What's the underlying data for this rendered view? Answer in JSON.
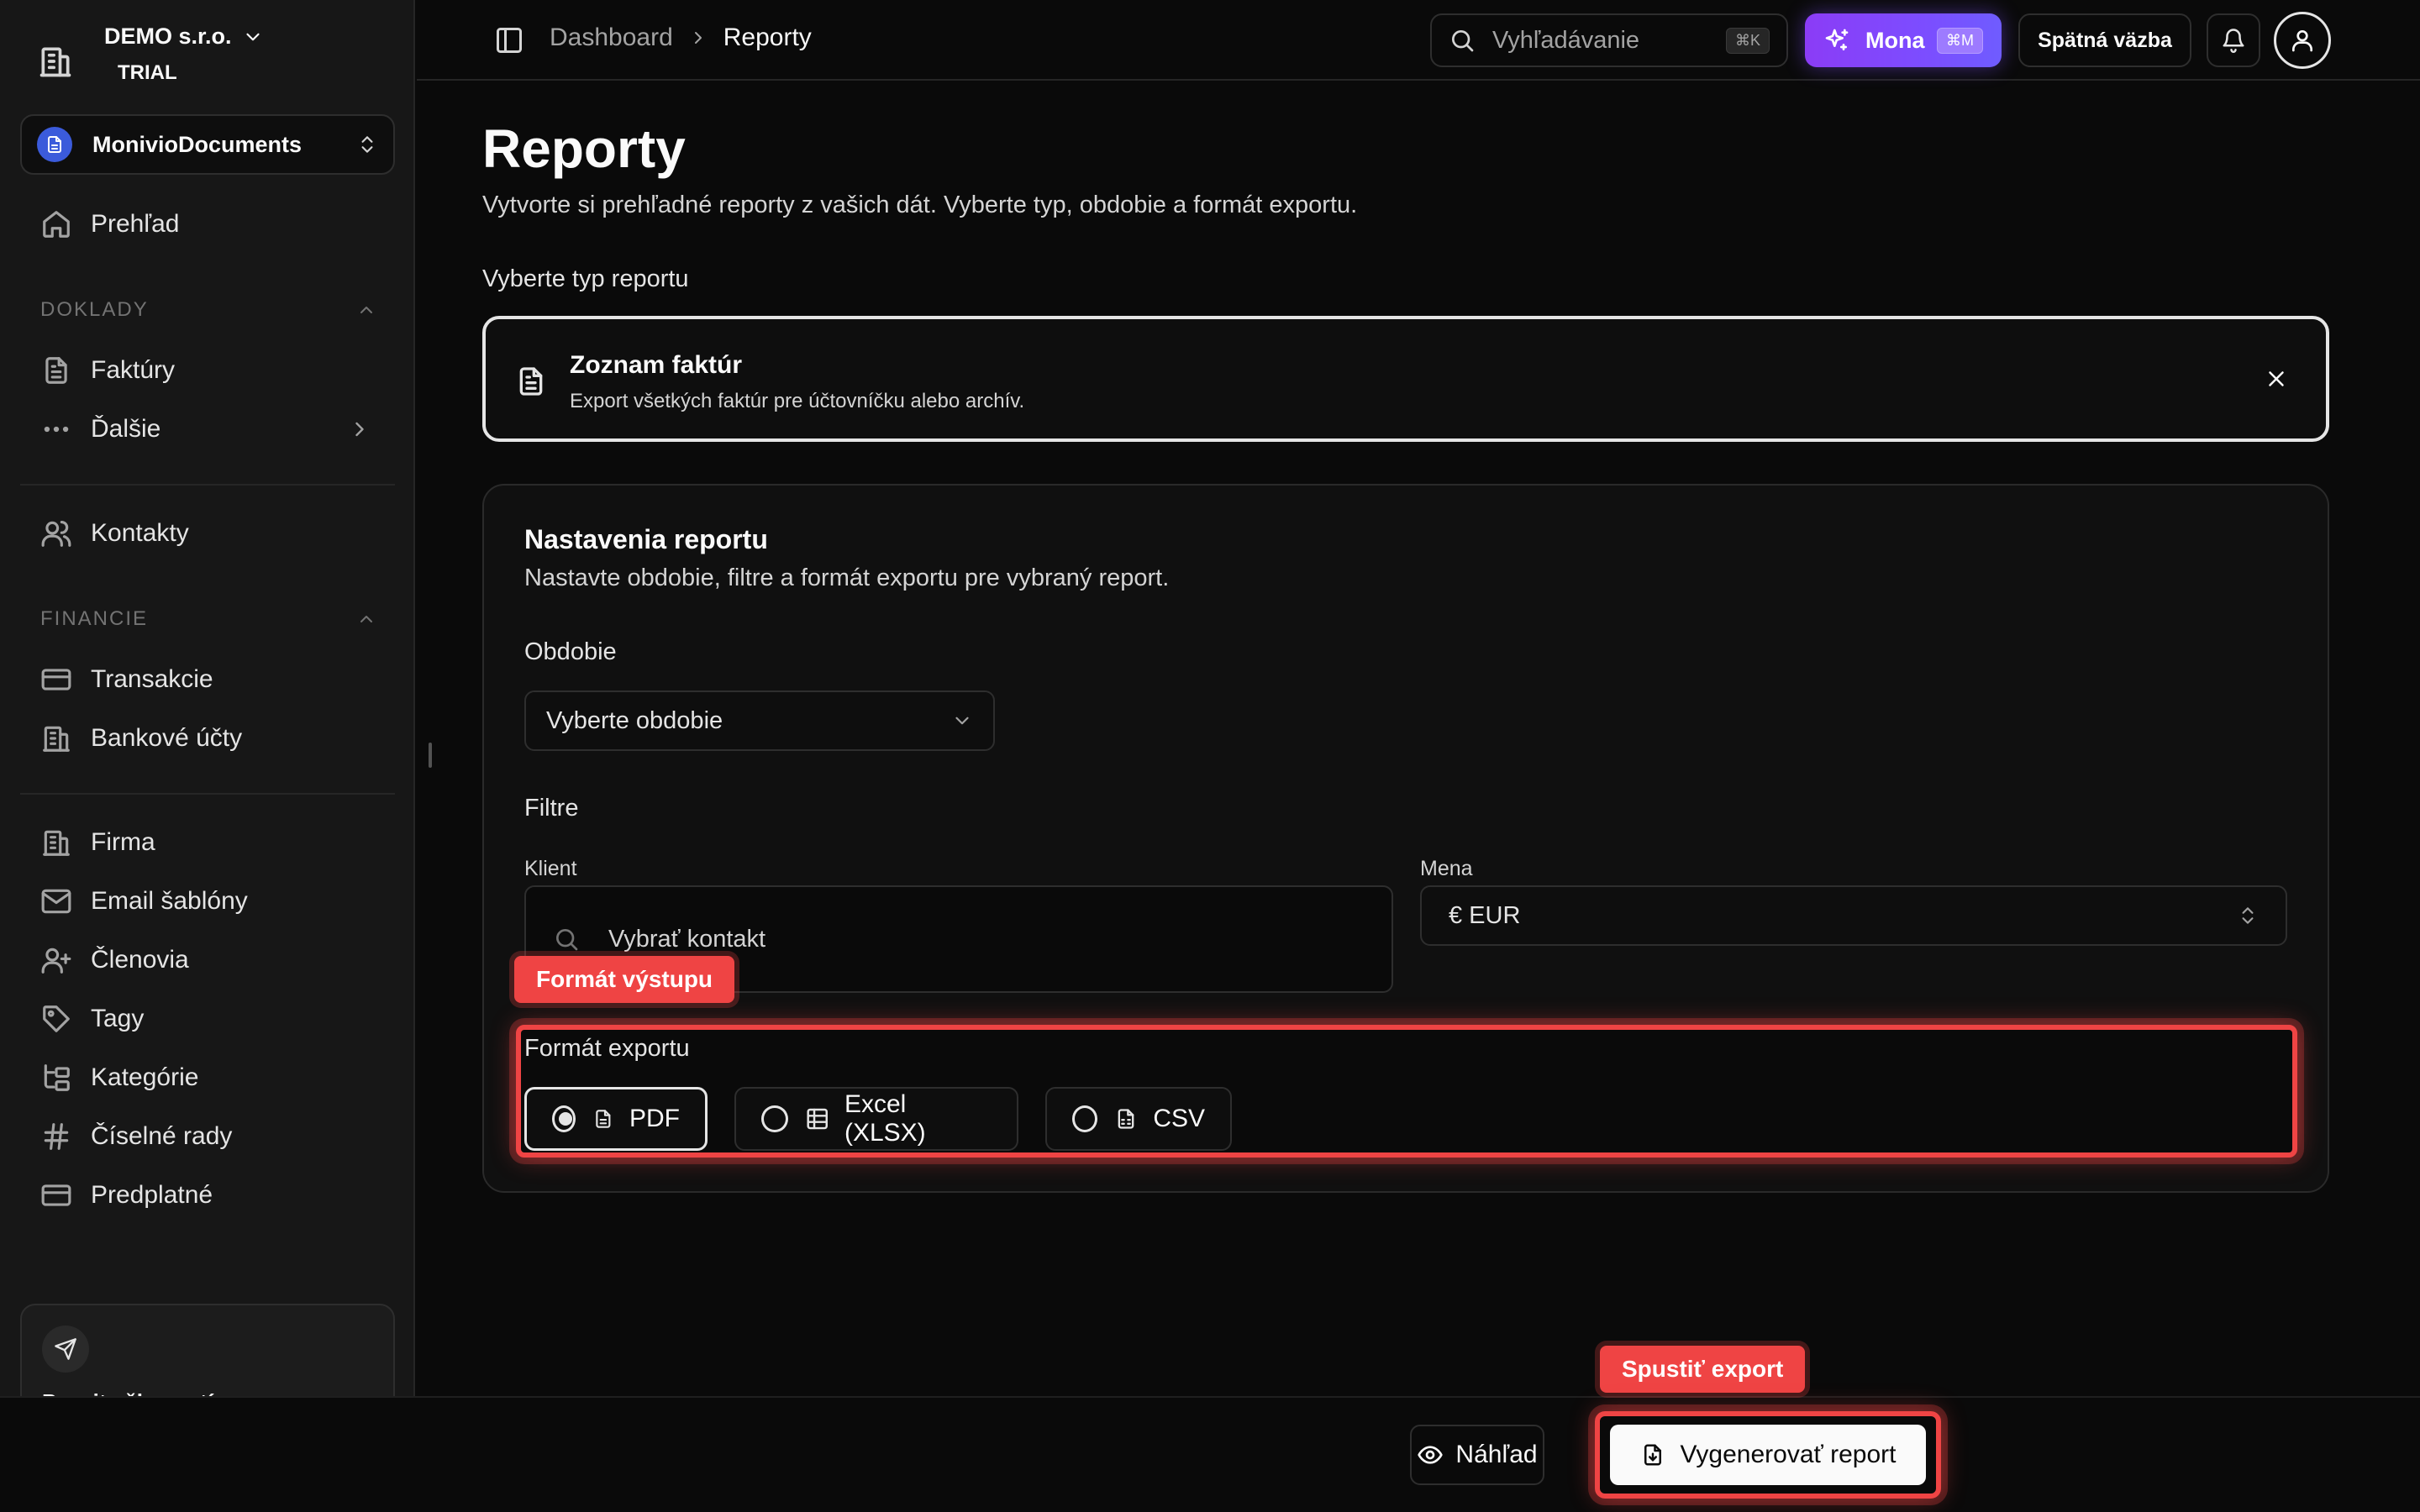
{
  "org": {
    "name": "DEMO s.r.o.",
    "plan": "TRIAL"
  },
  "workspace": {
    "name": "MonivioDocuments"
  },
  "sidebar": {
    "overview": "Prehľad",
    "sections": {
      "doklady": "DOKLADY",
      "financie": "FINANCIE"
    },
    "items": {
      "faktury": "Faktúry",
      "dalsie": "Ďalšie",
      "kontakty": "Kontakty",
      "transakcie": "Transakcie",
      "bankove_ucty": "Bankové účty",
      "firma": "Firma",
      "email_sablony": "Email šablóny",
      "clenovia": "Členovia",
      "tagy": "Tagy",
      "kategorie": "Kategórie",
      "ciselne_rady": "Číselné rady",
      "predplatne": "Predplatné"
    },
    "card_text": "Pozvite členov tímu"
  },
  "header": {
    "breadcrumb": [
      "Dashboard",
      "Reporty"
    ],
    "search_placeholder": "Vyhľadávanie",
    "search_shortcut": "⌘K",
    "mona_label": "Mona",
    "mona_shortcut": "⌘M",
    "feedback_label": "Spätná väzba"
  },
  "page": {
    "title": "Reporty",
    "subtitle": "Vytvorte si prehľadné reporty z vašich dát. Vyberte typ, obdobie a formát exportu.",
    "type_section_label": "Vyberte typ reportu",
    "selected_type": {
      "title": "Zoznam faktúr",
      "description": "Export všetkých faktúr pre účtovníčku alebo archív."
    }
  },
  "settings": {
    "title": "Nastavenia reportu",
    "subtitle": "Nastavte obdobie, filtre a formát exportu pre vybraný report.",
    "period_label": "Obdobie",
    "period_placeholder": "Vyberte obdobie",
    "filters_label": "Filtre",
    "client_label": "Klient",
    "client_placeholder": "Vybrať kontakt",
    "currency_label": "Mena",
    "currency_value": "€ EUR",
    "format_label": "Formát exportu",
    "formats": [
      {
        "label": "PDF",
        "selected": true
      },
      {
        "label": "Excel (XLSX)",
        "selected": false
      },
      {
        "label": "CSV",
        "selected": false
      }
    ]
  },
  "highlights": {
    "format_tag": "Formát výstupu",
    "export_tag": "Spustiť export",
    "color": "#ef4444"
  },
  "footer": {
    "preview_label": "Náhľad",
    "generate_label": "Vygenerovať report"
  }
}
